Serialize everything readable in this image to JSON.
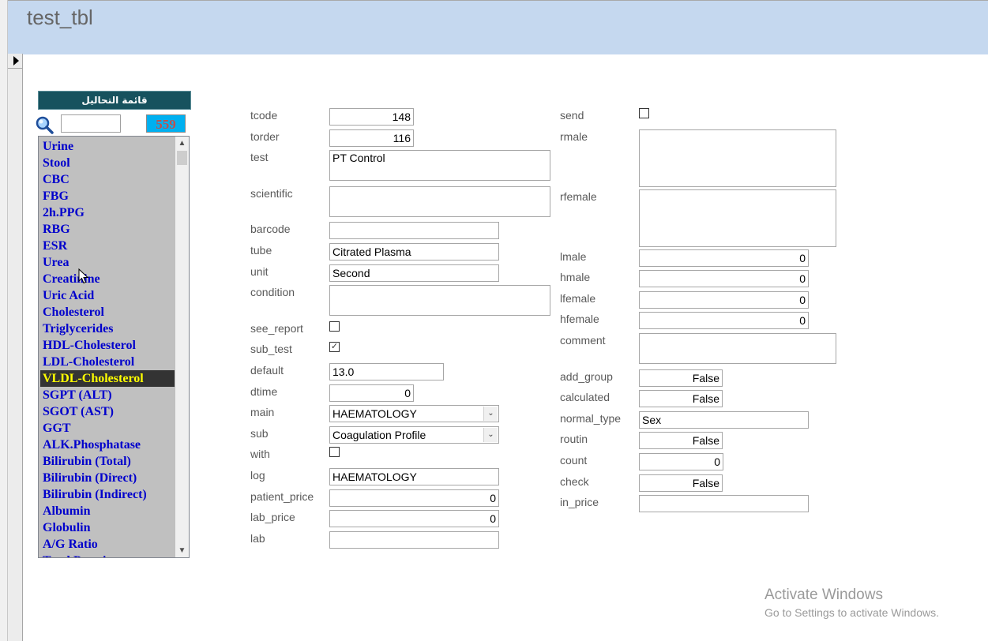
{
  "window": {
    "title": "test_tbl"
  },
  "list": {
    "header": "قائمة التحاليل",
    "search_value": "",
    "count": "559",
    "items": [
      "Urine",
      "Stool",
      "CBC",
      "FBG",
      "2h.PPG",
      "RBG",
      "ESR",
      "Urea",
      "Creatinine",
      "Uric Acid",
      "Cholesterol",
      "Triglycerides",
      "HDL-Cholesterol",
      "LDL-Cholesterol",
      "VLDL-Cholesterol",
      "SGPT (ALT)",
      "SGOT (AST)",
      "GGT",
      "ALK.Phosphatase",
      "Bilirubin (Total)",
      "Bilirubin (Direct)",
      "Bilirubin (Indirect)",
      "Albumin",
      "Globulin",
      "A/G Ratio",
      "Total Protein"
    ],
    "selected_item": "VLDL-Cholesterol",
    "scroll_up_icon": "chevron-up-icon",
    "scroll_down_icon": "chevron-down-icon"
  },
  "fields": {
    "tcode": {
      "label": "tcode",
      "value": "148"
    },
    "torder": {
      "label": "torder",
      "value": "116"
    },
    "test": {
      "label": "test",
      "value": "PT Control"
    },
    "scientific": {
      "label": "scientific",
      "value": ""
    },
    "barcode": {
      "label": "barcode",
      "value": ""
    },
    "tube": {
      "label": "tube",
      "value": "Citrated Plasma"
    },
    "unit": {
      "label": "unit",
      "value": "Second"
    },
    "condition": {
      "label": "condition",
      "value": ""
    },
    "see_report": {
      "label": "see_report",
      "checked": false
    },
    "sub_test": {
      "label": "sub_test",
      "checked": true
    },
    "default": {
      "label": "default",
      "value": "13.0"
    },
    "dtime": {
      "label": "dtime",
      "value": "0"
    },
    "main": {
      "label": "main",
      "value": "HAEMATOLOGY"
    },
    "sub": {
      "label": "sub",
      "value": "Coagulation Profile"
    },
    "with": {
      "label": "with",
      "checked": false
    },
    "log": {
      "label": "log",
      "value": "HAEMATOLOGY"
    },
    "patient_price": {
      "label": "patient_price",
      "value": "0"
    },
    "lab_price": {
      "label": "lab_price",
      "value": "0"
    },
    "lab": {
      "label": "lab",
      "value": ""
    },
    "send": {
      "label": "send",
      "checked": false
    },
    "rmale": {
      "label": "rmale",
      "value": ""
    },
    "rfemale": {
      "label": "rfemale",
      "value": ""
    },
    "lmale": {
      "label": "lmale",
      "value": "0"
    },
    "hmale": {
      "label": "hmale",
      "value": "0"
    },
    "lfemale": {
      "label": "lfemale",
      "value": "0"
    },
    "hfemale": {
      "label": "hfemale",
      "value": "0"
    },
    "comment": {
      "label": "comment",
      "value": ""
    },
    "add_group": {
      "label": "add_group",
      "value": "False"
    },
    "calculated": {
      "label": "calculated",
      "value": "False"
    },
    "normal_type": {
      "label": "normal_type",
      "value": "Sex"
    },
    "routin": {
      "label": "routin",
      "value": "False"
    },
    "count": {
      "label": "count",
      "value": "0"
    },
    "check": {
      "label": "check",
      "value": "False"
    },
    "in_price": {
      "label": "in_price",
      "value": ""
    }
  },
  "watermark": {
    "title": "Activate Windows",
    "subtitle": "Go to Settings to activate Windows."
  },
  "colors": {
    "header_band": "#c5d8ef",
    "list_header": "#17525e",
    "count_box": "#00b0f0",
    "list_item_text": "#0000cc",
    "selected_item_bg": "#333333",
    "selected_item_text": "#ffff00"
  }
}
